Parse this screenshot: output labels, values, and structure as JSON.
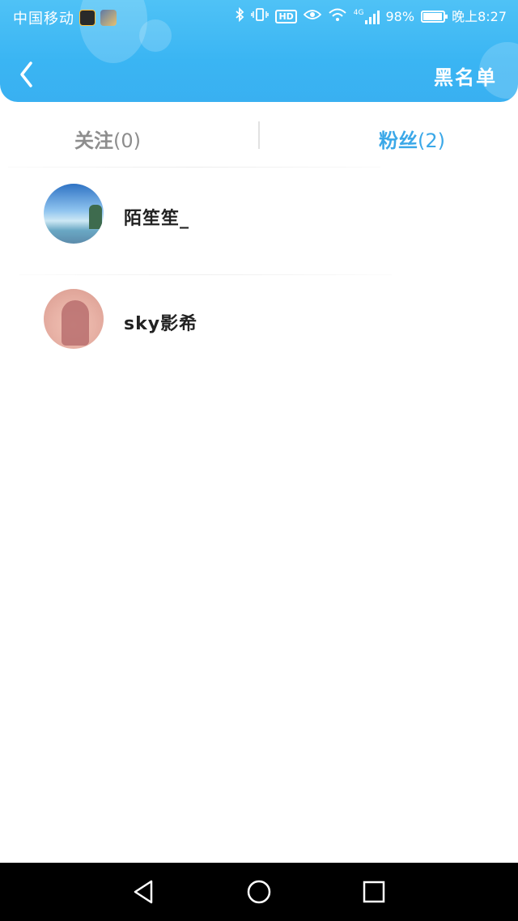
{
  "status_bar": {
    "carrier": "中国移动",
    "hd_badge": "HD",
    "network": "4G",
    "battery": "98%",
    "time": "晚上8:27"
  },
  "header": {
    "back_icon": "chevron-left-icon",
    "blacklist_label": "黑名单"
  },
  "tabs": [
    {
      "label": "关注",
      "count": "(0)",
      "active": false
    },
    {
      "label": "粉丝",
      "count": "(2)",
      "active": true
    }
  ],
  "fans": [
    {
      "username": "陌笙笙_",
      "avatar": "landscape-avatar"
    },
    {
      "username": "sky影希",
      "avatar": "silhouette-avatar"
    }
  ],
  "colors": {
    "header_gradient_top": "#4fc2f6",
    "header_gradient_bottom": "#39b0f1",
    "active_tab": "#3ba8e8",
    "inactive_tab": "#8d8d8d",
    "navbar_bg": "#000000"
  },
  "navbar": {
    "icons": [
      "triangle-back-icon",
      "circle-home-icon",
      "square-recent-icon"
    ]
  }
}
